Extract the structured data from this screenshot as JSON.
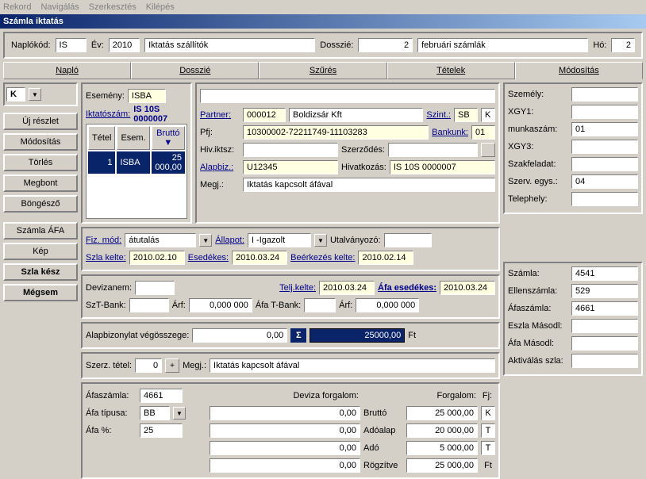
{
  "menubar": [
    "Rekord",
    "Navigálás",
    "Szerkesztés",
    "Kilépés"
  ],
  "title": "Számla iktatás",
  "header": {
    "naplokod_label": "Naplókód:",
    "naplokod": "IS",
    "ev_label": "Év:",
    "ev": "2010",
    "iktatas": "Iktatás szállítók",
    "dosszie_label": "Dosszié:",
    "dosszie_num": "2",
    "dosszie_name": "februári számlák",
    "ho_label": "Hó:",
    "ho": "2"
  },
  "tabs": [
    "Napló",
    "Dosszié",
    "Szűrés",
    "Tételek",
    "Módosítás"
  ],
  "k_val": "K",
  "esemeny_label": "Esemény:",
  "esemeny": "ISBA",
  "iktatoszam_label": "Iktatószám:",
  "iktatoszam": "IS 10S 0000007",
  "table": {
    "headers": [
      "Tétel",
      "Esem.",
      "Bruttó"
    ],
    "rows": [
      [
        "1",
        "ISBA",
        "25 000,00"
      ]
    ]
  },
  "partner_label": "Partner:",
  "partner_code": "000012",
  "partner_name": "Boldizsár Kft",
  "szint_label": "Szint.:",
  "szint": "SB",
  "szint_k": "K",
  "pfj_label": "Pfj:",
  "pfj": "10300002-72211749-11103283",
  "bankunk_label": "Bankunk:",
  "bankunk": "01",
  "hiviktsz_label": "Hiv.iktsz:",
  "szerzodes_label": "Szerződés:",
  "alapbiz_label": "Alapbiz.:",
  "alapbiz": "U12345",
  "hivatkozas_label": "Hivatkozás:",
  "hivatkozas": "IS 10S 0000007",
  "megj_label": "Megj.:",
  "megj": "Iktatás kapcsolt áfával",
  "left_buttons": {
    "uj_reszlet": "Új részlet",
    "modositas": "Módosítás",
    "torles": "Törlés",
    "megbont": "Megbont",
    "bongeszo": "Böngésző",
    "szamla_afa": "Számla ÁFA",
    "kep": "Kép",
    "szla_kesz": "Szla kész",
    "megsem": "Mégsem"
  },
  "fizmod_label": "Fiz. mód:",
  "fizmod": "átutalás",
  "allapot_label": "Állapot:",
  "allapot": "I  -Igazolt",
  "utalvanyozo_label": "Utalványozó:",
  "szla_kelte_label": "Szla kelte:",
  "szla_kelte": "2010.02.10",
  "esedekes_label": "Esedékes:",
  "esedekes": "2010.03.24",
  "beerkezes_label": "Beérkezés kelte:",
  "beerkezes": "2010.02.14",
  "devizanem_label": "Devizanem:",
  "teljkelte_label": "Telj.kelte:",
  "teljkelte": "2010.03.24",
  "afa_esedekes_label": "Áfa esedékes:",
  "afa_esedekes": "2010.03.24",
  "szt_bank_label": "SzT-Bank:",
  "arf_label": "Árf:",
  "arf1": "0,000 000",
  "afa_t_bank_label": "Áfa T-Bank:",
  "arf2": "0,000 000",
  "alapbiz_vegossz_label": "Alapbizonylat végösszege:",
  "alapbiz_vegossz": "0,00",
  "sigma_val": "25000,00",
  "ft": "Ft",
  "szerz_tetel_label": "Szerz. tétel:",
  "szerz_tetel": "0",
  "megj2_label": "Megj.:",
  "megj2": "Iktatás kapcsolt áfával",
  "afaszamla_label": "Áfaszámla:",
  "afaszamla": "4661",
  "afa_tipusa_label": "Áfa típusa:",
  "afa_tipusa": "BB",
  "afa_pct_label": "Áfa %:",
  "afa_pct": "25",
  "deviza_forgalom_label": "Deviza forgalom:",
  "forgalom_label": "Forgalom:",
  "fj_label": "Fj:",
  "dev_vals": [
    "0,00",
    "0,00",
    "0,00",
    "0,00"
  ],
  "forg_labels": [
    "Bruttó",
    "Adóalap",
    "Adó",
    "Rögzítve"
  ],
  "forg_vals": [
    "25 000,00",
    "20 000,00",
    "5 000,00",
    "25 000,00"
  ],
  "fj_vals": [
    "K",
    "T",
    "T",
    "Ft"
  ],
  "right": {
    "szemely": "Személy:",
    "xgy1": "XGY1:",
    "munkaszam": "munkaszám:",
    "munkaszam_val": "01",
    "xgy3": "XGY3:",
    "szakfeladat": "Szakfeladat:",
    "szerv_egys": "Szerv. egys.:",
    "szerv_egys_val": "04",
    "telephely": "Telephely:",
    "szamla": "Számla:",
    "szamla_val": "4541",
    "ellenszamla": "Ellenszámla:",
    "ellenszamla_val": "529",
    "afaszamla": "Áfaszámla:",
    "afaszamla_val": "4661",
    "eszla_masodl": "Eszla Másodl:",
    "afa_masodl": "Áfa Másodl:",
    "aktivalas_szla": "Aktiválás szla:"
  }
}
